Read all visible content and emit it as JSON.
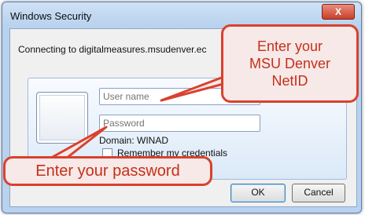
{
  "window": {
    "title": "Windows Security",
    "close_label": "X"
  },
  "dialog": {
    "connecting_text": "Connecting to digitalmeasures.msudenver.ec"
  },
  "credentials": {
    "username_placeholder": "User name",
    "password_placeholder": "Password",
    "domain_text": "Domain: WINAD",
    "remember_label": "Remember my credentials",
    "remember_checked": false
  },
  "buttons": {
    "ok_label": "OK",
    "cancel_label": "Cancel"
  },
  "annotations": {
    "netid_line1": "Enter your",
    "netid_line2": "MSU Denver",
    "netid_line3": "NetID",
    "password_text": "Enter your password"
  },
  "colors": {
    "callout_border": "#d9412e",
    "callout_fill": "#f6e9e7",
    "callout_text": "#c62f1b",
    "title_bar": "#b9d2ee"
  }
}
